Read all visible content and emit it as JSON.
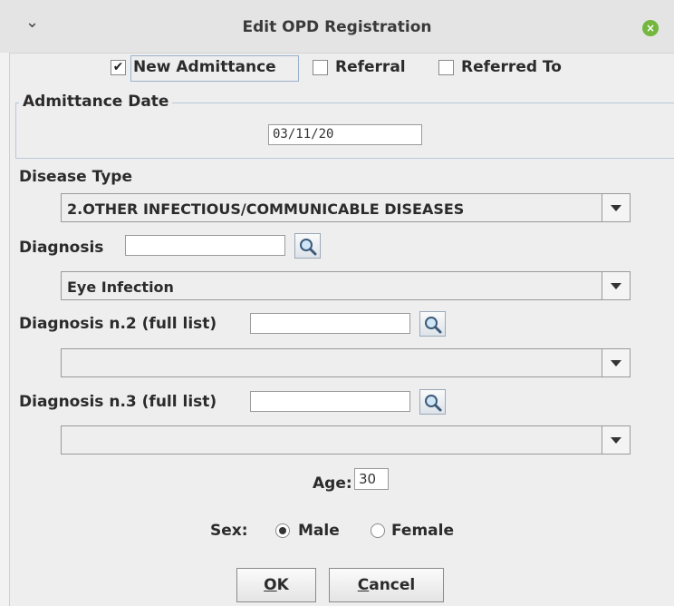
{
  "window": {
    "title": "Edit OPD Registration"
  },
  "visit_type": {
    "new_admittance": {
      "label": "New Admittance",
      "checked": true
    },
    "referral": {
      "label": "Referral",
      "checked": false
    },
    "referred_to": {
      "label": "Referred To",
      "checked": false
    }
  },
  "admittance": {
    "group_label": "Admittance Date",
    "date_value": "03/11/20"
  },
  "disease_type": {
    "label": "Disease Type",
    "selected": "2.OTHER INFECTIOUS/COMMUNICABLE DISEASES"
  },
  "diagnosis": {
    "label": "Diagnosis",
    "search_value": "",
    "selected": "Eye Infection"
  },
  "diagnosis2": {
    "label": "Diagnosis n.2 (full list)",
    "search_value": "",
    "selected": ""
  },
  "diagnosis3": {
    "label": "Diagnosis n.3 (full list)",
    "search_value": "",
    "selected": ""
  },
  "age": {
    "label": "Age:",
    "value": "30"
  },
  "sex": {
    "label": "Sex:",
    "options": [
      {
        "label": "Male",
        "selected": true
      },
      {
        "label": "Female",
        "selected": false
      }
    ]
  },
  "buttons": {
    "ok": {
      "mnemonic": "O",
      "rest": "K"
    },
    "cancel": {
      "mnemonic": "C",
      "rest": "ancel"
    }
  },
  "icons": {
    "search": "magnifier-icon",
    "dropdown": "triangle-down-icon",
    "close": "close-icon",
    "menu": "chevron-down-icon"
  },
  "colors": {
    "close_button": "#73b73f"
  }
}
